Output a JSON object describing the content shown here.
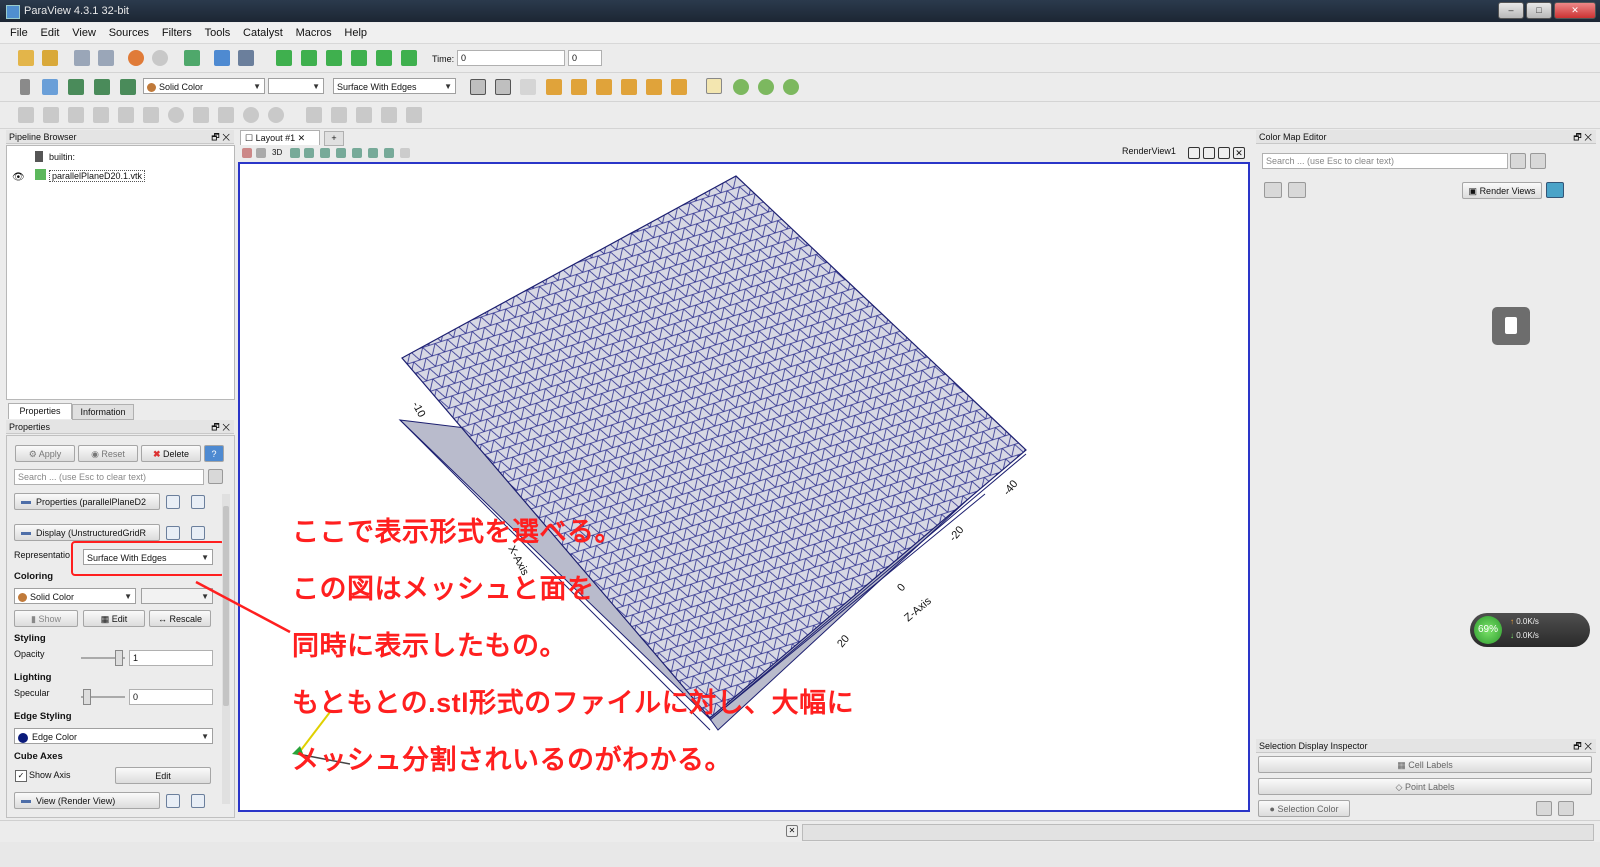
{
  "window": {
    "title": "ParaView 4.3.1 32-bit",
    "controls": [
      "–",
      "□",
      "✕"
    ]
  },
  "menu": [
    "File",
    "Edit",
    "View",
    "Sources",
    "Filters",
    "Tools",
    "Catalyst",
    "Macros",
    "Help"
  ],
  "toolbar": {
    "time_label": "Time:",
    "time_value": "0",
    "timestep_value": "0",
    "coloring_combo": "Solid Color",
    "representation_combo": "Surface With Edges"
  },
  "pipeline": {
    "header": "Pipeline Browser",
    "items": [
      "builtin:",
      "parallelPlaneD20.1.vtk"
    ]
  },
  "props_tabs": [
    "Properties",
    "Information"
  ],
  "properties": {
    "header": "Properties",
    "apply": "Apply",
    "reset": "Reset",
    "delete": "Delete",
    "help": "?",
    "search_placeholder": "Search ... (use Esc to clear text)",
    "section_properties": "Properties (parallelPlaneD2",
    "section_display": "Display (UnstructuredGridR",
    "representation_label": "Representatio",
    "representation_value": "Surface With Edges",
    "coloring_label": "Coloring",
    "coloring_value": "Solid Color",
    "show_btn": "Show",
    "edit_btn": "Edit",
    "rescale_btn": "Rescale",
    "styling_label": "Styling",
    "opacity_label": "Opacity",
    "opacity_value": "1",
    "lighting_label": "Lighting",
    "specular_label": "Specular",
    "specular_value": "0",
    "edge_styling_label": "Edge Styling",
    "edge_color": "Edge Color",
    "cube_axes_label": "Cube Axes",
    "show_axis": "Show Axis",
    "show_axis_edit": "Edit",
    "section_view": "View (Render View)"
  },
  "layout": {
    "tab": "Layout #1",
    "add": "+",
    "view_name": "RenderView1",
    "mode_3d": "3D"
  },
  "render": {
    "axis_labels": {
      "x": "X-Axis",
      "z": "Z-Axis"
    },
    "z_ticks": [
      "-40",
      "-20",
      "0",
      "20"
    ],
    "x_ticks": [
      "-10"
    ]
  },
  "annotation": {
    "lines": [
      "ここで表示形式を選べる。",
      "この図はメッシュと面を",
      "同時に表示したもの。",
      "もともとの.stl形式のファイルに対し、大幅に",
      "メッシュ分割されいるのがわかる。"
    ],
    "color": "#ff1f1f"
  },
  "colormap": {
    "header": "Color Map Editor",
    "search_placeholder": "Search ... (use Esc to clear text)",
    "render_views": "Render Views"
  },
  "selection": {
    "header": "Selection Display Inspector",
    "cell_labels": "Cell Labels",
    "point_labels": "Point Labels",
    "selection_color": "Selection Color"
  },
  "netmeter": {
    "percent": "69%",
    "up": "0.0K/s",
    "down": "0.0K/s"
  }
}
